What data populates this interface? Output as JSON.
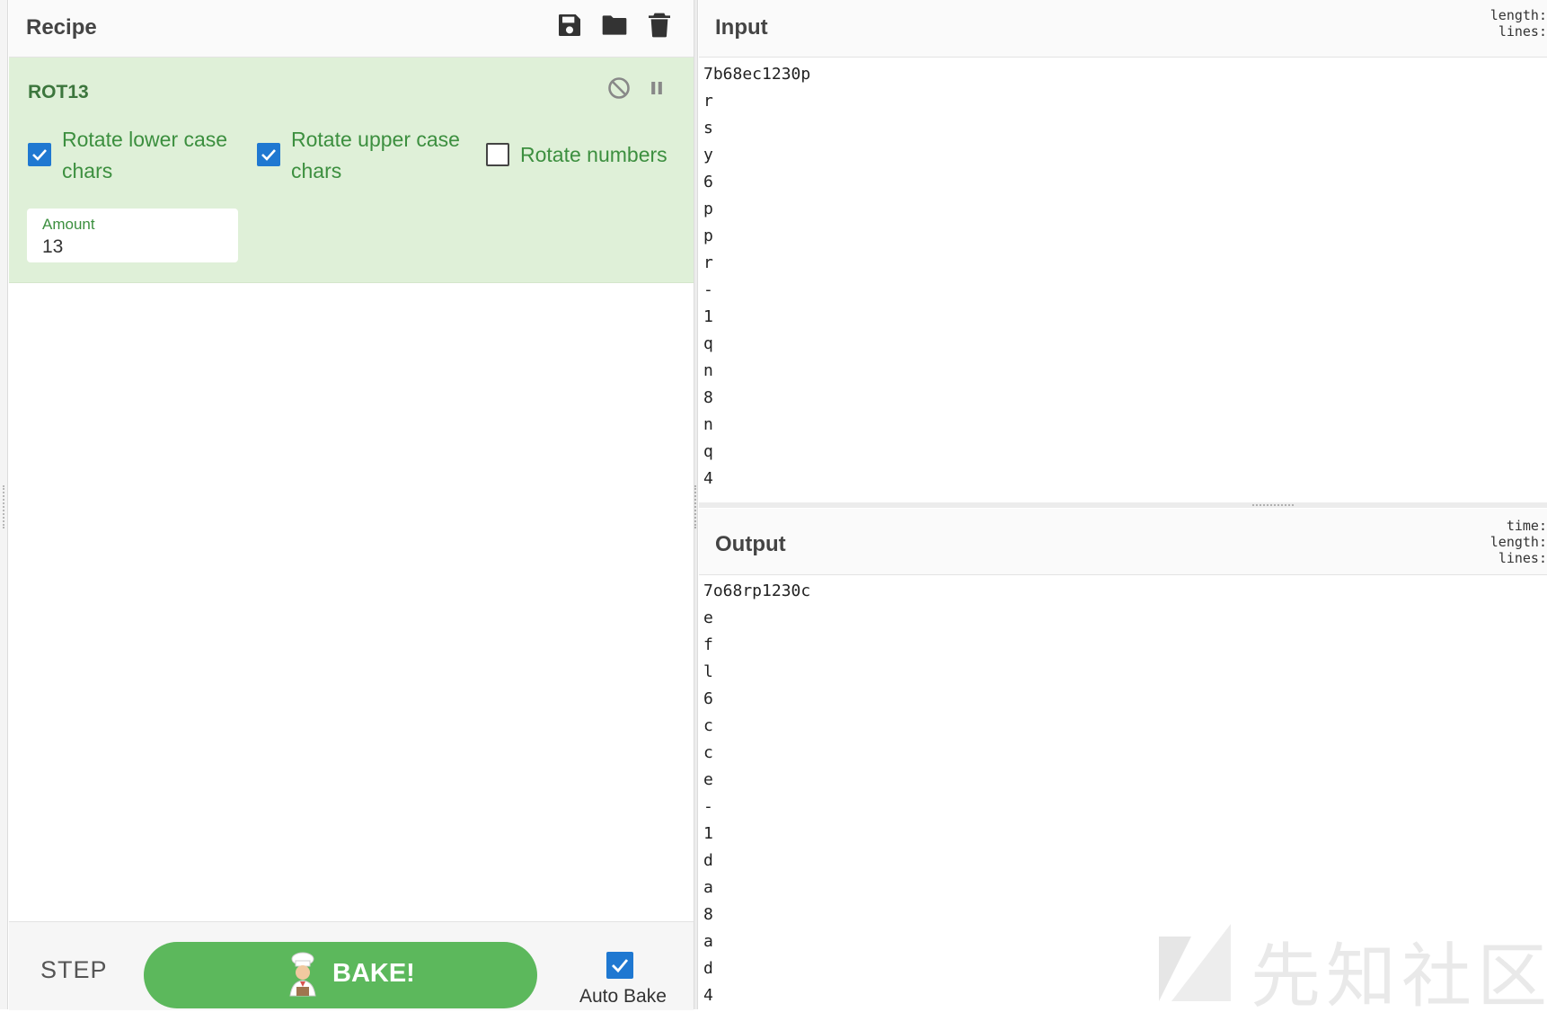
{
  "recipe": {
    "title": "Recipe",
    "icons": [
      "save-icon",
      "folder-icon",
      "trash-icon"
    ],
    "operation": {
      "name": "ROT13",
      "icons": [
        "disable-icon",
        "breakpoint-icon"
      ],
      "rotate_lower": {
        "label_line1": "Rotate lower case",
        "label_line2": "chars",
        "checked": true
      },
      "rotate_upper": {
        "label_line1": "Rotate upper case",
        "label_line2": "chars",
        "checked": true
      },
      "rotate_numbers": {
        "label": "Rotate numbers",
        "checked": false
      },
      "amount": {
        "label": "Amount",
        "value": "13"
      }
    },
    "footer": {
      "step_label": "STEP",
      "bake_label": "BAKE!",
      "auto_bake_label": "Auto Bake",
      "auto_bake_checked": true
    }
  },
  "input": {
    "title": "Input",
    "stats": [
      "length:",
      "lines:"
    ],
    "lines": [
      "7b68ec1230p",
      "r",
      "s",
      "y",
      "6",
      "p",
      "p",
      "r",
      "-",
      "1",
      "q",
      "n",
      "8",
      "n",
      "q",
      "4"
    ]
  },
  "output": {
    "title": "Output",
    "stats": [
      "time:",
      "length:",
      "lines:"
    ],
    "lines": [
      "7o68rp1230c",
      "e",
      "f",
      "l",
      "6",
      "c",
      "c",
      "e",
      "-",
      "1",
      "d",
      "a",
      "8",
      "a",
      "d",
      "4"
    ]
  },
  "colors": {
    "operation_bg": "#dff0d8",
    "operation_text": "#3c763d",
    "checkbox_blue": "#1f78d1",
    "bake_green": "#5cb85c"
  },
  "watermark": {
    "text": "先知社区"
  }
}
